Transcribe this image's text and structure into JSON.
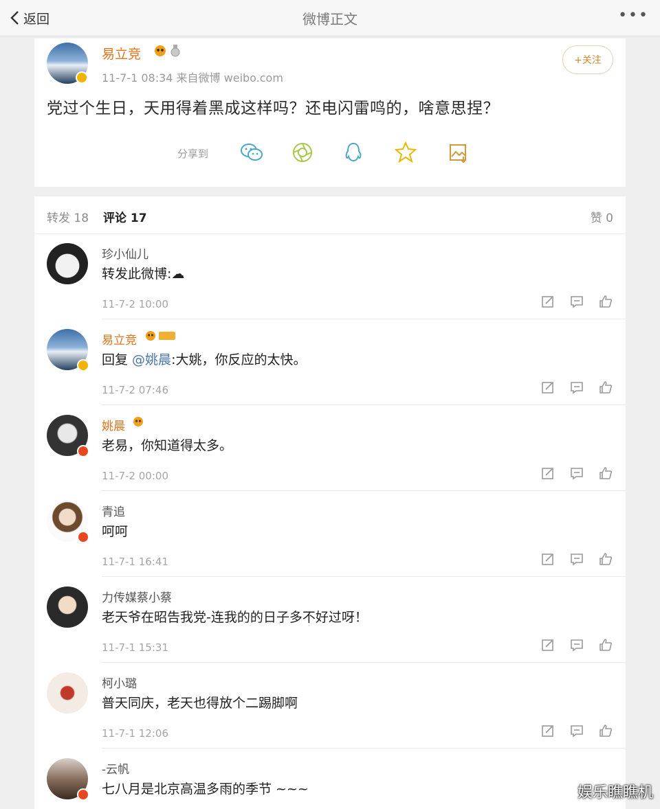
{
  "navbar": {
    "back_label": "返回",
    "title": "微博正文",
    "more_label": "•••"
  },
  "post": {
    "author": "易立竞",
    "meta": "11-7-1 08:34  来自微博 weibo.com",
    "follow_label": "+关注",
    "text": "党过个生日，天用得着黑成这样吗？还电闪雷鸣的，啥意思捏？",
    "share_label": "分享到",
    "share_targets": [
      "wechat-icon",
      "moments-icon",
      "qq-icon",
      "qzone-icon",
      "save-image-icon"
    ]
  },
  "tabs": {
    "repost": "转发 18",
    "comment": "评论 17",
    "like": "赞 0"
  },
  "comments": [
    {
      "name": "珍小仙儿",
      "text": "转发此微博:☁",
      "time": "11-7-2 10:00"
    },
    {
      "name": "易立竞",
      "prefix": "回复 ",
      "mention": "@姚晨",
      "text": ":大姚，你反应的太快。",
      "time": "11-7-2 07:46"
    },
    {
      "name": "姚晨",
      "text": "老易，你知道得太多。",
      "time": "11-7-2 00:00"
    },
    {
      "name": "青追",
      "text": "呵呵",
      "time": "11-7-1 16:41"
    },
    {
      "name": "力传媒蔡小蔡",
      "text": "老天爷在昭告我党-连我的的日子多不好过呀！",
      "time": "11-7-1 15:31"
    },
    {
      "name": "柯小璐",
      "text": "普天同庆，老天也得放个二踢脚啊",
      "time": "11-7-1 12:06"
    },
    {
      "name": "-云帆",
      "text": "七八月是北京高温多雨的季节 ~~~",
      "time": ""
    }
  ],
  "watermark": "娱乐瞧瞧机",
  "colors": {
    "accent_orange": "#e2721b",
    "mention_blue": "#4a76a8",
    "follow_gold": "#d08a2c"
  }
}
